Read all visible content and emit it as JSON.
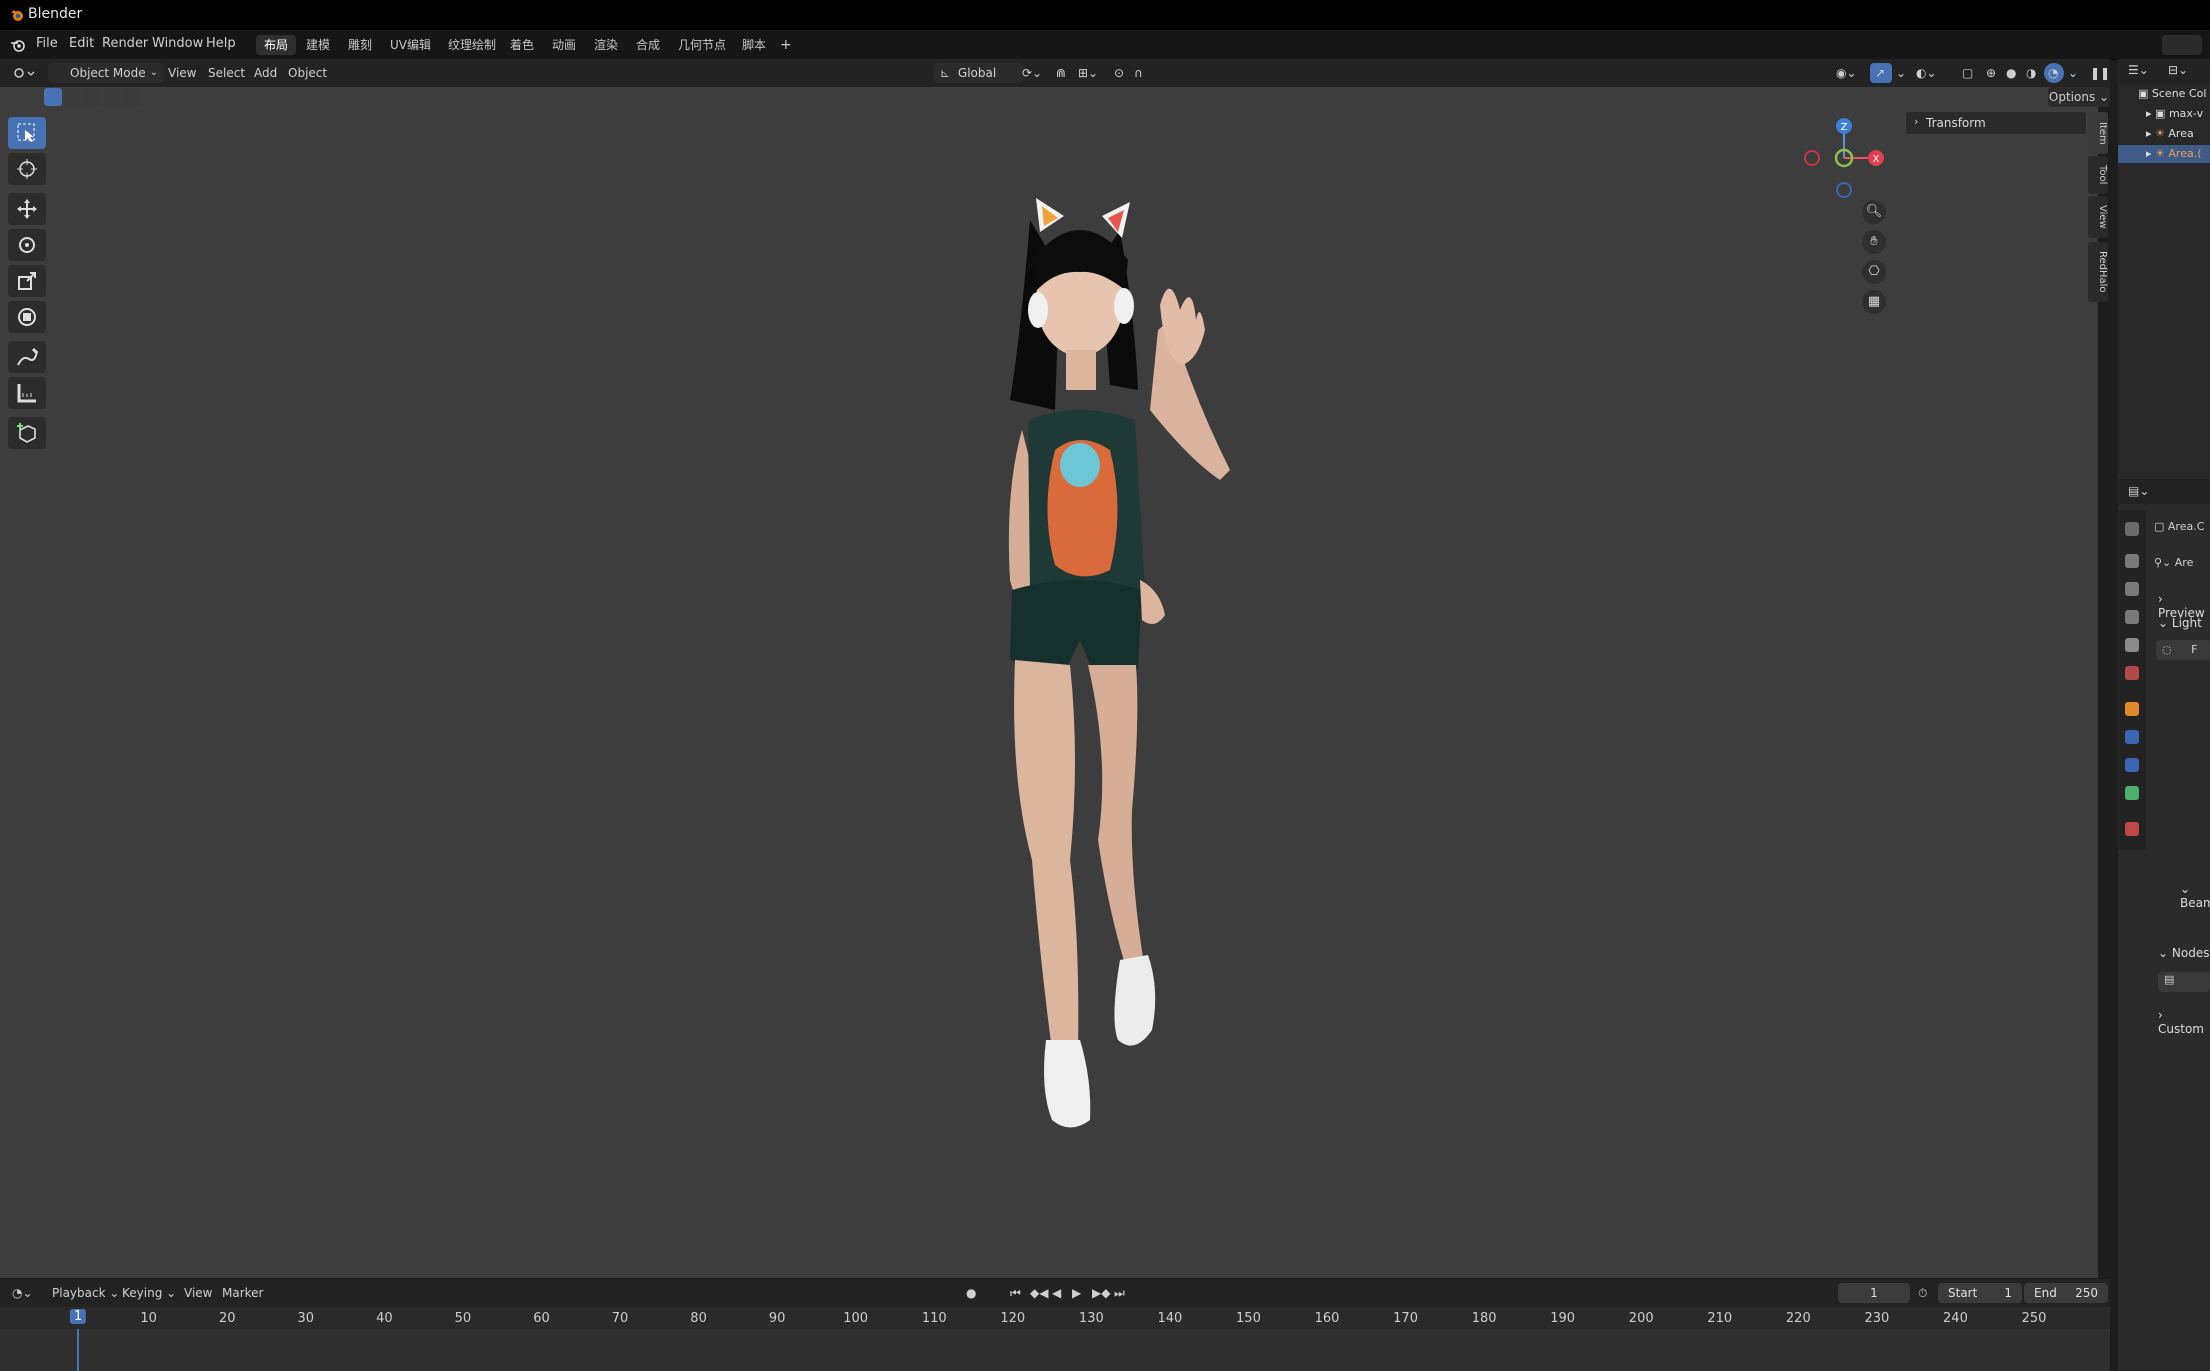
{
  "app": {
    "title": "Blender"
  },
  "menu": {
    "file": "File",
    "edit": "Edit",
    "render": "Render",
    "window": "Window",
    "help": "Help"
  },
  "workspaces": [
    "布局",
    "建模",
    "雕刻",
    "UV编辑",
    "纹理绘制",
    "着色",
    "动画",
    "渲染",
    "合成",
    "几何节点",
    "脚本"
  ],
  "workspace_add": "+",
  "viewport_header": {
    "mode": "Object Mode",
    "view": "View",
    "select": "Select",
    "add": "Add",
    "object": "Object",
    "transform_orientation": "Global",
    "options": "Options"
  },
  "npanel": {
    "transform": "Transform",
    "tabs": [
      "Item",
      "Tool",
      "View",
      "RedHalo"
    ]
  },
  "gizmo": {
    "z": "Z",
    "x": "X"
  },
  "outliner": {
    "scene_collection": "Scene Col",
    "items": [
      "max-v",
      "Area",
      "Area.("
    ]
  },
  "properties": {
    "object_name": "Area.C",
    "data_name": "Are",
    "preview": "Preview",
    "light": "Light",
    "light_field": "F",
    "beam": "Beam",
    "nodes": "Nodes",
    "custom": "Custom"
  },
  "timeline": {
    "playback": "Playback",
    "keying": "Keying",
    "view": "View",
    "marker": "Marker",
    "current_frame": "1",
    "start_label": "Start",
    "start_value": "1",
    "end_label": "End",
    "end_value": "250",
    "ruler_ticks": [
      "1",
      "10",
      "20",
      "30",
      "40",
      "50",
      "60",
      "70",
      "80",
      "90",
      "100",
      "110",
      "120",
      "130",
      "140",
      "150",
      "160",
      "170",
      "180",
      "190",
      "200",
      "210",
      "220",
      "230",
      "240",
      "250"
    ]
  },
  "colors": {
    "accent": "#4772b3",
    "viewport_bg": "#3d3d3d",
    "panel_bg": "#2b2b2b"
  }
}
